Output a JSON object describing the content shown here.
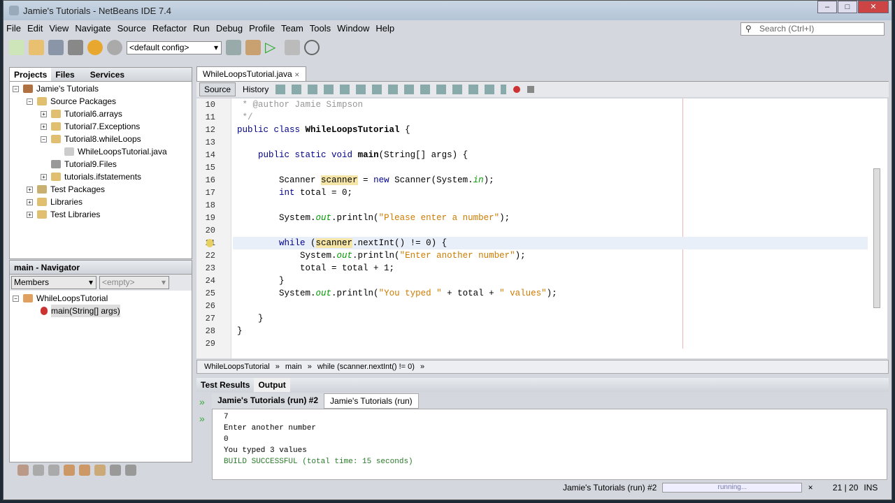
{
  "title": "Jamie's Tutorials - NetBeans IDE 7.4",
  "menu": [
    "File",
    "Edit",
    "View",
    "Navigate",
    "Source",
    "Refactor",
    "Run",
    "Debug",
    "Profile",
    "Team",
    "Tools",
    "Window",
    "Help"
  ],
  "search_placeholder": "Search (Ctrl+I)",
  "config": "<default config>",
  "projects": {
    "tabs": [
      "Projects",
      "Files",
      "Services"
    ],
    "tree": [
      "Jamie's Tutorials",
      "Source Packages",
      "Tutorial6.arrays",
      "Tutorial7.Exceptions",
      "Tutorial8.whileLoops",
      "WhileLoopsTutorial.java",
      "Tutorial9.Files",
      "tutorials.ifstatements",
      "Test Packages",
      "Libraries",
      "Test Libraries"
    ]
  },
  "navigator": {
    "title": "main - Navigator",
    "filter": "Members",
    "empty": "<empty>",
    "tree": [
      "WhileLoopsTutorial",
      "main(String[] args)"
    ]
  },
  "editor": {
    "tab": "WhileLoopsTutorial.java",
    "source": "Source",
    "history": "History",
    "line_numbers": [
      "10",
      "11",
      "12",
      "13",
      "14",
      "15",
      "16",
      "17",
      "18",
      "19",
      "20",
      "21",
      "22",
      "23",
      "24",
      "25",
      "26",
      "27",
      "28",
      "29"
    ],
    "breadcrumb": [
      "WhileLoopsTutorial",
      "main",
      "while (scanner.nextInt() != 0)"
    ]
  },
  "output": {
    "tabs": [
      "Test Results",
      "Output"
    ],
    "subtabs": [
      "Jamie's Tutorials (run) #2",
      "Jamie's Tutorials (run)"
    ],
    "lines": [
      "7",
      "Enter another number",
      "0",
      "You typed 3 values"
    ],
    "build": "BUILD SUCCESSFUL (total time: 15 seconds)"
  },
  "status": {
    "task": "Jamie's Tutorials (run) #2",
    "progress": "running...",
    "position": "21 | 20",
    "mode": "INS"
  }
}
